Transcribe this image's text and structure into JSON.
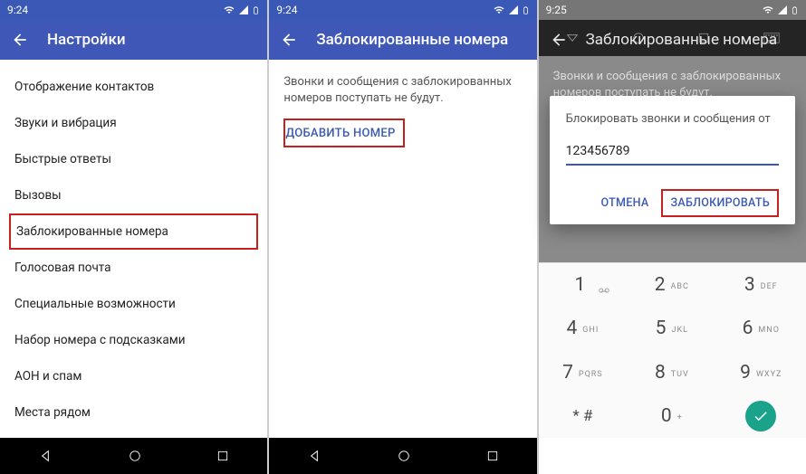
{
  "s1": {
    "time": "9:24",
    "title": "Настройки",
    "items": [
      "Отображение контактов",
      "Звуки и вибрация",
      "Быстрые ответы",
      "Вызовы",
      "Заблокированные номера",
      "Голосовая почта",
      "Специальные возможности",
      "Набор номера с подсказками",
      "АОН и спам",
      "Места рядом"
    ]
  },
  "s2": {
    "time": "9:24",
    "title": "Заблокированные номера",
    "desc": "Звонки и сообщения с заблокированных номеров поступать не будут.",
    "add": "ДОБАВИТЬ НОМЕР"
  },
  "s3": {
    "time": "9:25",
    "title": "Заблокированные номера",
    "desc": "Звонки и сообщения с заблокированных номеров поступать не будут.",
    "dlg_title": "Блокировать звонки и сообщения от",
    "input_value": "123456789",
    "cancel": "ОТМЕНА",
    "block": "ЗАБЛОКИРОВАТЬ",
    "keys": [
      {
        "d": "1",
        "l": ""
      },
      {
        "d": "2",
        "l": "ABC"
      },
      {
        "d": "3",
        "l": "DEF"
      },
      {
        "d": "4",
        "l": "GHI"
      },
      {
        "d": "5",
        "l": "JKL"
      },
      {
        "d": "6",
        "l": "MNO"
      },
      {
        "d": "7",
        "l": "PQRS"
      },
      {
        "d": "8",
        "l": "TUV"
      },
      {
        "d": "9",
        "l": "WXYZ"
      },
      {
        "d": "* #",
        "l": ""
      },
      {
        "d": "0",
        "l": "+"
      }
    ]
  }
}
